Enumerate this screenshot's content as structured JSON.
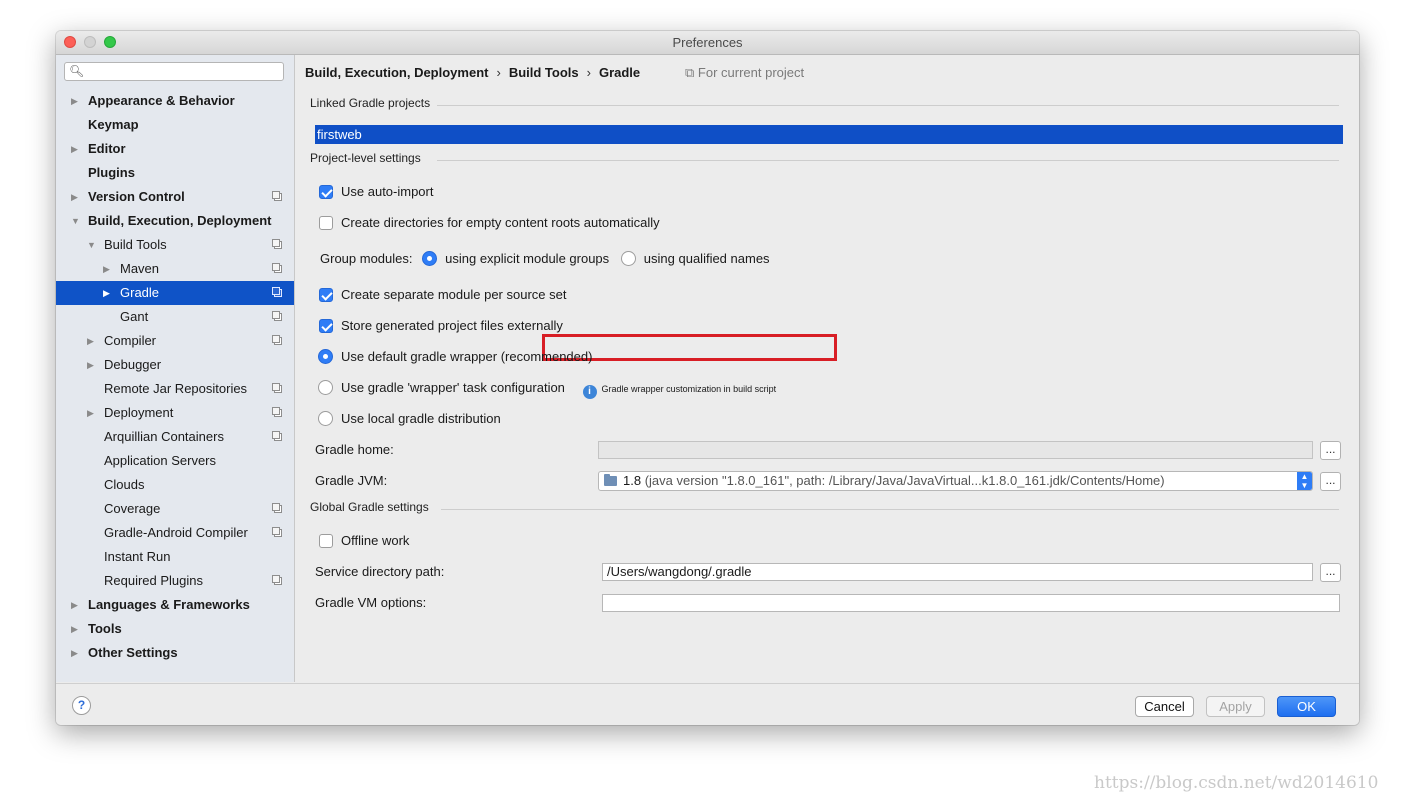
{
  "window": {
    "title": "Preferences"
  },
  "search": {
    "placeholder": ""
  },
  "sidebar": {
    "items": [
      {
        "label": "Appearance & Behavior",
        "arrow": "▶",
        "bold": true,
        "indent": 0,
        "project": false
      },
      {
        "label": "Keymap",
        "arrow": "",
        "bold": true,
        "indent": 0,
        "project": false
      },
      {
        "label": "Editor",
        "arrow": "▶",
        "bold": true,
        "indent": 0,
        "project": false
      },
      {
        "label": "Plugins",
        "arrow": "",
        "bold": true,
        "indent": 0,
        "project": false
      },
      {
        "label": "Version Control",
        "arrow": "▶",
        "bold": true,
        "indent": 0,
        "project": true
      },
      {
        "label": "Build, Execution, Deployment",
        "arrow": "▼",
        "bold": true,
        "indent": 0,
        "project": false
      },
      {
        "label": "Build Tools",
        "arrow": "▼",
        "bold": false,
        "indent": 1,
        "project": true
      },
      {
        "label": "Maven",
        "arrow": "▶",
        "bold": false,
        "indent": 2,
        "project": true
      },
      {
        "label": "Gradle",
        "arrow": "▶",
        "bold": false,
        "indent": 2,
        "project": true,
        "selected": true
      },
      {
        "label": "Gant",
        "arrow": "",
        "bold": false,
        "indent": 2,
        "project": true
      },
      {
        "label": "Compiler",
        "arrow": "▶",
        "bold": false,
        "indent": 1,
        "project": true
      },
      {
        "label": "Debugger",
        "arrow": "▶",
        "bold": false,
        "indent": 1,
        "project": false
      },
      {
        "label": "Remote Jar Repositories",
        "arrow": "",
        "bold": false,
        "indent": 1,
        "project": true
      },
      {
        "label": "Deployment",
        "arrow": "▶",
        "bold": false,
        "indent": 1,
        "project": true
      },
      {
        "label": "Arquillian Containers",
        "arrow": "",
        "bold": false,
        "indent": 1,
        "project": true
      },
      {
        "label": "Application Servers",
        "arrow": "",
        "bold": false,
        "indent": 1,
        "project": false
      },
      {
        "label": "Clouds",
        "arrow": "",
        "bold": false,
        "indent": 1,
        "project": false
      },
      {
        "label": "Coverage",
        "arrow": "",
        "bold": false,
        "indent": 1,
        "project": true
      },
      {
        "label": "Gradle-Android Compiler",
        "arrow": "",
        "bold": false,
        "indent": 1,
        "project": true
      },
      {
        "label": "Instant Run",
        "arrow": "",
        "bold": false,
        "indent": 1,
        "project": false
      },
      {
        "label": "Required Plugins",
        "arrow": "",
        "bold": false,
        "indent": 1,
        "project": true
      },
      {
        "label": "Languages & Frameworks",
        "arrow": "▶",
        "bold": true,
        "indent": 0,
        "project": false
      },
      {
        "label": "Tools",
        "arrow": "▶",
        "bold": true,
        "indent": 0,
        "project": false
      },
      {
        "label": "Other Settings",
        "arrow": "▶",
        "bold": true,
        "indent": 0,
        "project": false
      }
    ]
  },
  "breadcrumb": {
    "part1": "Build, Execution, Deployment",
    "sep": "›",
    "part2": "Build Tools",
    "part3": "Gradle",
    "scope_icon": "project-scope-icon",
    "scope": "For current project"
  },
  "sections": {
    "linked": "Linked Gradle projects",
    "project_level": "Project-level settings",
    "global": "Global Gradle settings"
  },
  "linked_projects": [
    "firstweb"
  ],
  "options": {
    "auto_import": {
      "label": "Use auto-import",
      "checked": true
    },
    "create_dirs": {
      "label": "Create directories for empty content roots automatically",
      "checked": false
    },
    "group_modules_label": "Group modules:",
    "group_explicit": {
      "label": "using explicit module groups",
      "selected": true
    },
    "group_qualified": {
      "label": "using qualified names",
      "selected": false
    },
    "separate_module": {
      "label": "Create separate module per source set",
      "checked": true
    },
    "store_external": {
      "label": "Store generated project files externally",
      "checked": true
    },
    "wrapper_default": {
      "label": "Use default gradle wrapper (recommended)",
      "selected": true
    },
    "wrapper_task": {
      "label": "Use gradle 'wrapper' task configuration",
      "selected": false
    },
    "wrapper_hint": "Gradle wrapper customization in build script",
    "local_dist": {
      "label": "Use local gradle distribution",
      "selected": false
    }
  },
  "fields": {
    "gradle_home_label": "Gradle home:",
    "gradle_home_value": "",
    "jvm_label": "Gradle JVM:",
    "jvm_version": "1.8",
    "jvm_detail": "(java version \"1.8.0_161\", path: /Library/Java/JavaVirtual...k1.8.0_161.jdk/Contents/Home)",
    "browse": "...",
    "offline": {
      "label": "Offline work",
      "checked": false
    },
    "service_dir_label": "Service directory path:",
    "service_dir_value": "/Users/wangdong/.gradle",
    "vm_options_label": "Gradle VM options:",
    "vm_options_value": ""
  },
  "footer": {
    "help": "?",
    "cancel": "Cancel",
    "apply": "Apply",
    "ok": "OK"
  },
  "watermark": "https://blog.csdn.net/wd2014610",
  "colors": {
    "selection": "#0f53c7",
    "accent": "#2f7df6",
    "highlight_box": "#d81e25"
  }
}
